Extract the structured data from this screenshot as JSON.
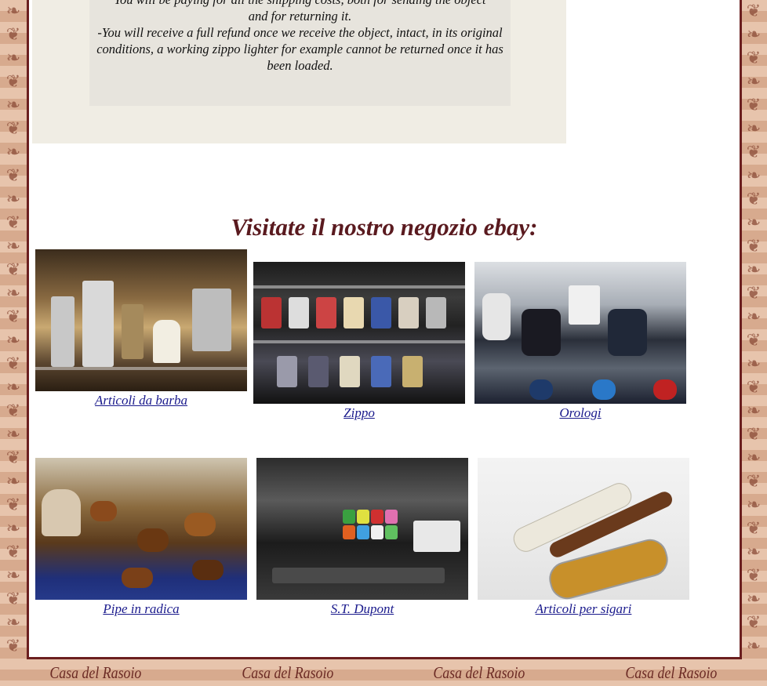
{
  "notice": {
    "line1": "You will be paying for all the shipping costs, both for sending the object",
    "line2": "and for returning it.",
    "line3": "-You will receive a full refund once we receive the object, intact, in its original conditions, a working zippo lighter for example cannot be returned once it has been loaded."
  },
  "heading": "Visitate il nostro negozio ebay:",
  "categories": [
    {
      "label": "Articoli da barba"
    },
    {
      "label": "Zippo"
    },
    {
      "label": "Orologi"
    },
    {
      "label": "Pipe in radica"
    },
    {
      "label": "S.T. Dupont"
    },
    {
      "label": "Articoli per sigari"
    }
  ],
  "footer": {
    "brand": [
      "Casa del Rasoio",
      "Casa del Rasoio",
      "Casa del Rasoio",
      "Casa del Rasoio"
    ]
  },
  "colors": {
    "frame": "#6b1f1f",
    "heading": "#5a1a1f",
    "link": "#1a1a8c",
    "background": "#e2b79a"
  }
}
